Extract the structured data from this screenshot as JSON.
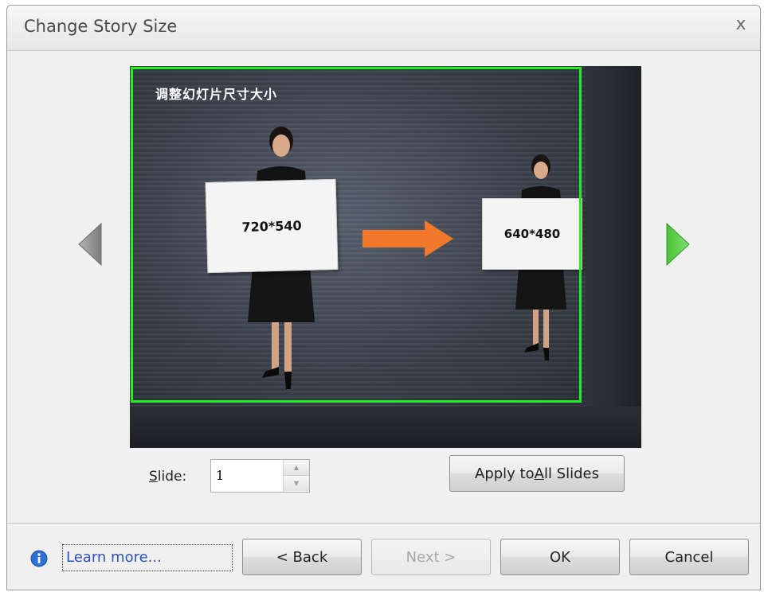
{
  "dialog": {
    "title": "Change Story Size",
    "close_glyph": "x"
  },
  "preview": {
    "heading": "调整幻灯片尺寸大小",
    "sign_left": "720*540",
    "sign_right": "640*480",
    "frame_color": "#22ee22",
    "arrow_color": "#f07a2a"
  },
  "controls": {
    "slide_label_pre": "",
    "slide_label_mnemonic": "S",
    "slide_label_post": "lide:",
    "slide_value": "1",
    "apply_pre": "Apply to ",
    "apply_mnemonic": "A",
    "apply_post": "ll Slides"
  },
  "footer": {
    "learn_more": "Learn more...",
    "back": "< Back",
    "next": "Next >",
    "ok": "OK",
    "cancel": "Cancel"
  },
  "icons": {
    "prev": "chevron-left-icon",
    "next": "chevron-right-icon",
    "info": "info-icon",
    "close": "close-icon"
  }
}
